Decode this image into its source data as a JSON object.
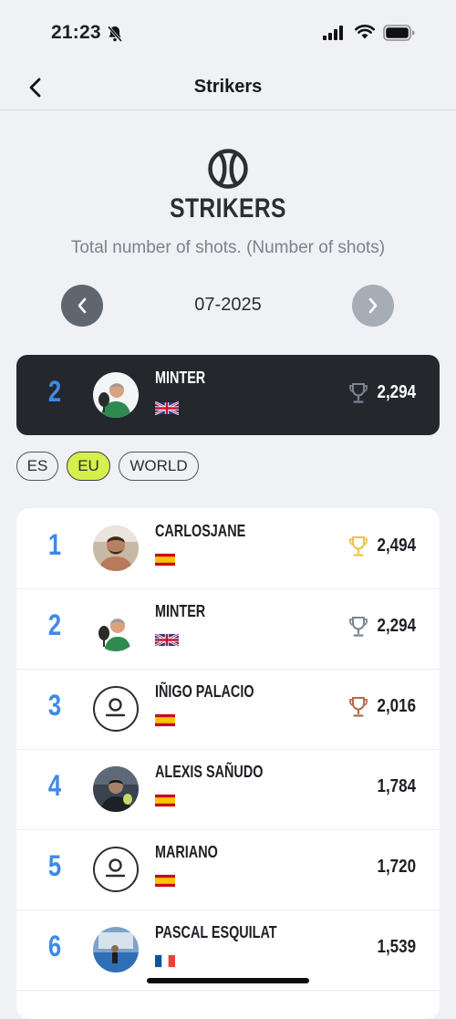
{
  "status_bar": {
    "time": "21:23"
  },
  "nav": {
    "title": "Strikers"
  },
  "header": {
    "title": "STRIKERS",
    "subtitle": "Total number of shots. (Number of shots)"
  },
  "period": {
    "label": "07-2025"
  },
  "my_rank": {
    "rank": "2",
    "name": "MINTER",
    "flag": "uk-flag",
    "score": "2,294",
    "trophy": "silver"
  },
  "regions": [
    {
      "label": "ES",
      "active": false
    },
    {
      "label": "EU",
      "active": true
    },
    {
      "label": "WORLD",
      "active": false
    }
  ],
  "ranking": [
    {
      "rank": "1",
      "name": "CARLOSJANE",
      "flag": "spain-flag",
      "score": "2,494",
      "trophy": "gold"
    },
    {
      "rank": "2",
      "name": "MINTER",
      "flag": "uk-flag",
      "score": "2,294",
      "trophy": "silver"
    },
    {
      "rank": "3",
      "name": "IÑIGO PALACIO",
      "flag": "spain-flag",
      "score": "2,016",
      "trophy": "bronze"
    },
    {
      "rank": "4",
      "name": "ALEXIS SAÑUDO",
      "flag": "spain-flag",
      "score": "1,784",
      "trophy": ""
    },
    {
      "rank": "5",
      "name": "MARIANO",
      "flag": "spain-flag",
      "score": "1,720",
      "trophy": ""
    },
    {
      "rank": "6",
      "name": "PASCAL ESQUILAT",
      "flag": "france-flag",
      "score": "1,539",
      "trophy": ""
    }
  ],
  "colors": {
    "accent_blue": "#3e8ae6",
    "pill_active": "#d5f04a",
    "gold": "#e6c54a",
    "silver": "#7c8594",
    "bronze": "#b36a4a"
  }
}
